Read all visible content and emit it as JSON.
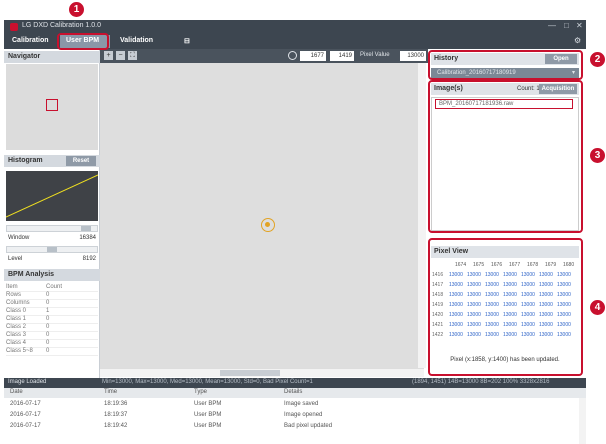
{
  "window": {
    "title": "LG DXD Calibration 1.0.0",
    "minimize_glyph": "—",
    "close_glyph": "✕",
    "gear_icon": "gear-icon"
  },
  "menu": {
    "items": [
      "Calibration",
      "User BPM",
      "Validation",
      "⊟"
    ],
    "active": "User BPM"
  },
  "callouts": [
    "1",
    "2",
    "3",
    "4"
  ],
  "navigator": {
    "title": "Navigator"
  },
  "histogram": {
    "title": "Histogram",
    "reset_label": "Reset",
    "window_label": "Window",
    "window_value": "16384",
    "level_label": "Level",
    "level_value": "8192"
  },
  "bpm_analysis": {
    "title": "BPM Analysis",
    "columns": [
      "Item",
      "Count"
    ],
    "rows": [
      [
        "Rows",
        "0"
      ],
      [
        "Columns",
        "0"
      ],
      [
        "Class 0",
        "1"
      ],
      [
        "Class 1",
        "0"
      ],
      [
        "Class 2",
        "0"
      ],
      [
        "Class 3",
        "0"
      ],
      [
        "Class 4",
        "0"
      ],
      [
        "Class 5~8",
        "0"
      ]
    ]
  },
  "toolbar": {
    "zoom_in": "+",
    "zoom_out": "−",
    "fit": "⛶",
    "x_value": "1677",
    "y_value": "1419",
    "pixel_value_label": "Pixel Value",
    "pixel_value": "13000"
  },
  "history": {
    "title": "History",
    "open_label": "Open",
    "selected": "Calibration_20160717180919"
  },
  "images": {
    "title": "Image(s)",
    "count_label": "Count: 1",
    "acquisition_label": "Acquisition",
    "items": [
      "BPM_20160717181936.raw"
    ]
  },
  "pixel_view": {
    "title": "Pixel View",
    "columns": [
      "1674",
      "1675",
      "1676",
      "1677",
      "1678",
      "1679",
      "1680"
    ],
    "rows": [
      {
        "label": "1416",
        "values": [
          "13000",
          "13000",
          "13000",
          "13000",
          "13000",
          "13000",
          "13000"
        ]
      },
      {
        "label": "1417",
        "values": [
          "13000",
          "13000",
          "13000",
          "13000",
          "13000",
          "13000",
          "13000"
        ]
      },
      {
        "label": "1418",
        "values": [
          "13000",
          "13000",
          "13000",
          "13000",
          "13000",
          "13000",
          "13000"
        ]
      },
      {
        "label": "1419",
        "values": [
          "13000",
          "13000",
          "13000",
          "13000",
          "13000",
          "13000",
          "13000"
        ]
      },
      {
        "label": "1420",
        "values": [
          "13000",
          "13000",
          "13000",
          "13000",
          "13000",
          "13000",
          "13000"
        ]
      },
      {
        "label": "1421",
        "values": [
          "13000",
          "13000",
          "13000",
          "13000",
          "13000",
          "13000",
          "13000"
        ]
      },
      {
        "label": "1422",
        "values": [
          "13000",
          "13000",
          "13000",
          "13000",
          "13000",
          "13000",
          "13000"
        ]
      }
    ],
    "status": "Pixel (x:1858, y:1400) has been updated."
  },
  "statusbar": {
    "left": "Image Loaded",
    "stats": "Min=13000, Max=13000, Med=13000, Mean=13000, Std=0, Bad Pixel Count=1",
    "right": "(1894, 1451)  14B=13000  8B=202  100%  3328x2816"
  },
  "log": {
    "columns": [
      "Date",
      "Time",
      "Type",
      "Details"
    ],
    "rows": [
      [
        "2016-07-17",
        "18:19:36",
        "User BPM",
        "Image saved"
      ],
      [
        "2016-07-17",
        "18:19:37",
        "User BPM",
        "Image opened"
      ],
      [
        "2016-07-17",
        "18:19:42",
        "User BPM",
        "Bad pixel updated"
      ]
    ]
  }
}
